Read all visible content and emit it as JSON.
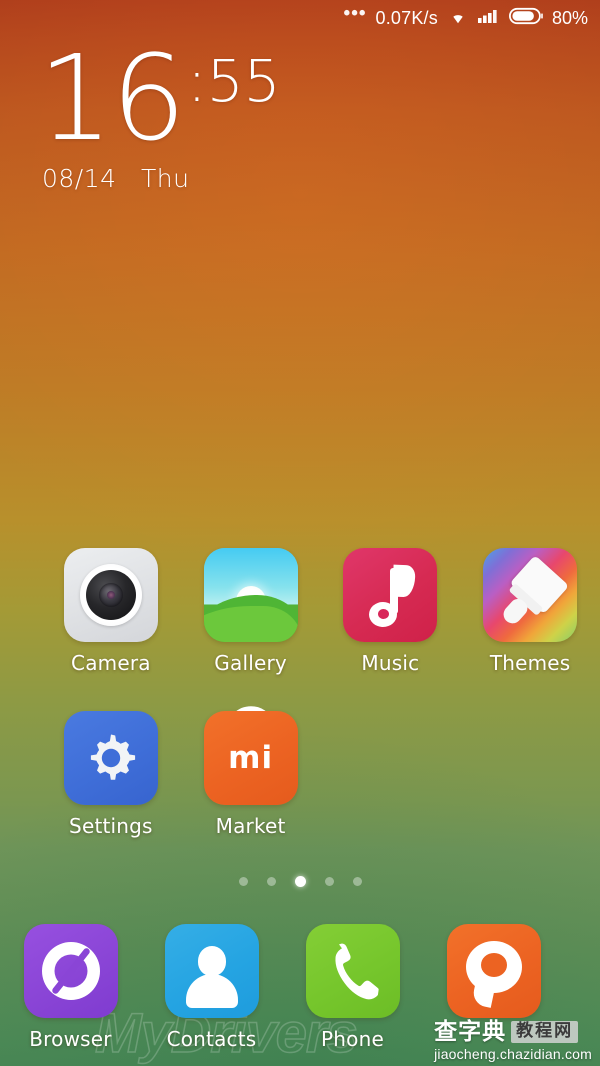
{
  "statusbar": {
    "more_icon": "overflow-dots-icon",
    "network_speed": "0.07K/s",
    "wifi_icon": "wifi-icon",
    "signal_icon": "cellular-signal-icon",
    "battery_icon": "battery-icon",
    "battery_level": "80%"
  },
  "clock": {
    "hour": "16",
    "minute": ":55",
    "date": "08/14",
    "day_of_week": "Thu"
  },
  "home_screen": {
    "rows": [
      {
        "apps": [
          {
            "label": "Camera",
            "icon": "camera-icon",
            "color": "#e2e4e7"
          },
          {
            "label": "Gallery",
            "icon": "gallery-icon",
            "color": "#53b236"
          },
          {
            "label": "Music",
            "icon": "music-icon",
            "color": "#d62a52"
          },
          {
            "label": "Themes",
            "icon": "themes-icon",
            "color": "#e8476d"
          }
        ]
      },
      {
        "apps": [
          {
            "label": "Settings",
            "icon": "settings-gear-icon",
            "color": "#3f6ed8"
          },
          {
            "label": "Market",
            "icon": "mi-market-bag-icon",
            "color": "#ec6322"
          }
        ]
      }
    ]
  },
  "page_indicator": {
    "total": 5,
    "current": 3
  },
  "dock": {
    "apps": [
      {
        "label": "Browser",
        "icon": "browser-swirl-icon",
        "color": "#8a45d6"
      },
      {
        "label": "Contacts",
        "icon": "contacts-person-icon",
        "color": "#25a4e2"
      },
      {
        "label": "Phone",
        "icon": "phone-handset-icon",
        "color": "#76c62c"
      },
      {
        "label": "",
        "icon": "messaging-bubble-icon",
        "color": "#ec6322"
      }
    ]
  },
  "watermarks": {
    "overlay_text": "MyDrivers",
    "site_cn": "查字典",
    "site_badge": "教程网",
    "site_url": "jiaocheng.chazidian.com"
  },
  "theme": {
    "wallpaper_top": "#ae3d1c",
    "wallpaper_mid": "#b8902c",
    "wallpaper_bottom": "#4a8755",
    "label_color": "#ffffff"
  }
}
